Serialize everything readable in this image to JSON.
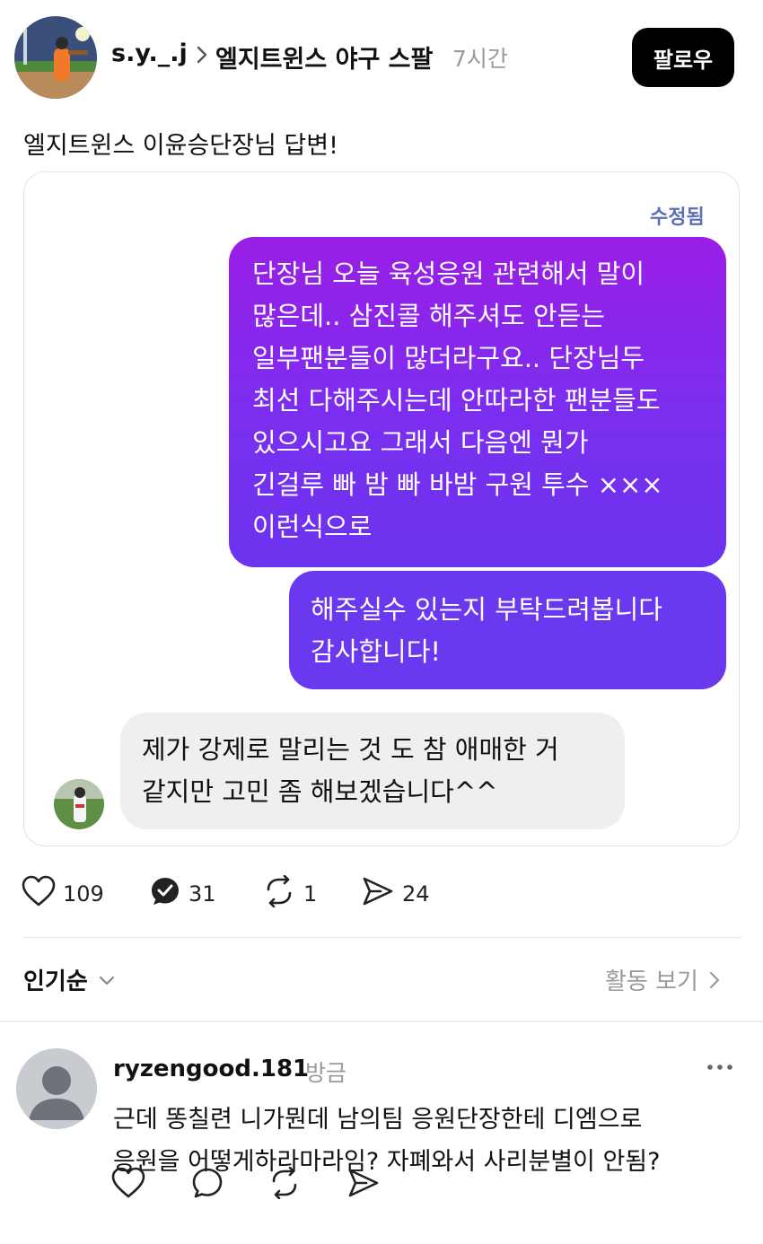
{
  "post": {
    "username": "s.y._.j",
    "community": "엘지트윈스 야구 스팔",
    "time": "7시간",
    "follow_label": "팔로우",
    "text": "엘지트윈스 이윤승단장님 답변!"
  },
  "chat": {
    "edited_label": "수정됨",
    "message1_lines": [
      "단장님 오늘 육성응원 관련해서 말이",
      "많은데.. 삼진콜 해주셔도 안듣는",
      "일부팬분들이 많더라구요.. 단장님두",
      "최선 다해주시는데 안따라한 팬분들도",
      "있으시고요 그래서 다음엔 뭔가",
      "긴걸루 빠 밤 빠 바밤 구원 투수 ×××",
      "이런식으로"
    ],
    "message2_lines": [
      "해주실수 있는지 부탁드려봅니다",
      "감사합니다!"
    ],
    "reply_lines": [
      "제가 강제로 말리는 것 도 참 애매한 거",
      "같지만 고민 좀 해보겠습니다^^"
    ]
  },
  "actions": {
    "likes": "109",
    "comments": "31",
    "reposts": "1",
    "shares": "24"
  },
  "sort": {
    "label": "인기순",
    "activity_label": "활동 보기"
  },
  "comment": {
    "username": "ryzengood.181",
    "time": "방금",
    "lines": [
      "근데 똥칠련 니가뭔데 남의팀 응원단장한테 디엠으로",
      "응원을 어떻게하라마라임? 자폐와서 사리분별이 안됨?"
    ]
  },
  "colors": {
    "bubble_purple_top": "#9a1ee6",
    "bubble_purple_bottom": "#6a38ee",
    "edited_blue": "#5a6fb6",
    "follow_bg": "#000000"
  }
}
